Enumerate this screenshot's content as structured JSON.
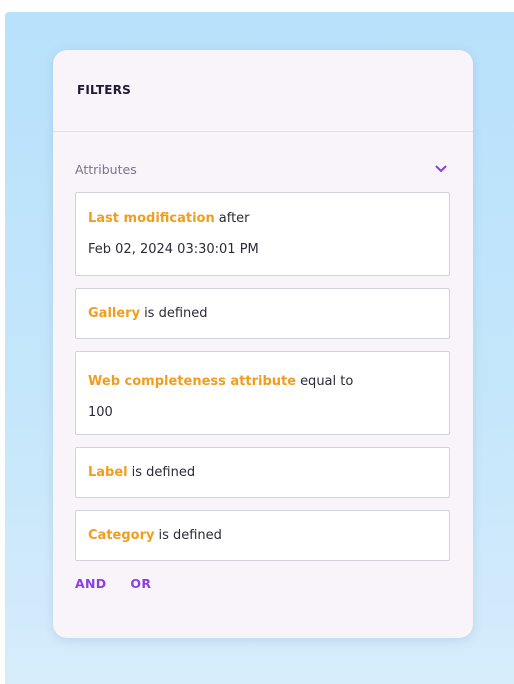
{
  "panel": {
    "title": "FILTERS"
  },
  "section": {
    "label": "Attributes",
    "toggle_icon": "chevron-down-icon",
    "accent_color": "#8a3fe0"
  },
  "filters": [
    {
      "attribute": "Last modification",
      "operator": "after",
      "value": "Feb 02, 2024 03:30:01 PM"
    },
    {
      "attribute": "Gallery",
      "operator": "is defined"
    },
    {
      "attribute": "Web completeness attribute",
      "operator": "equal to",
      "value": "100"
    },
    {
      "attribute": "Label",
      "operator": "is defined"
    },
    {
      "attribute": "Category",
      "operator": "is defined"
    }
  ],
  "logic": {
    "and_label": "AND",
    "or_label": "OR"
  },
  "colors": {
    "attribute_name": "#f19d1e",
    "panel_background": "#f9f3fa",
    "backdrop": "#c4e6fb"
  }
}
